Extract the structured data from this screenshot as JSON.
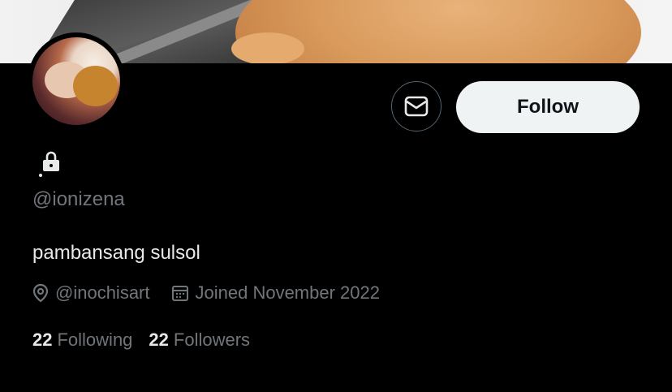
{
  "profile": {
    "handle": "@ionizena",
    "bio": "pambansang sulsol",
    "website": "@inochisart",
    "joined": "Joined November 2022",
    "following_count": "22",
    "following_label": "Following",
    "followers_count": "22",
    "followers_label": "Followers",
    "protected": true
  },
  "actions": {
    "follow_label": "Follow",
    "message_icon": "envelope-icon"
  },
  "colors": {
    "background": "#000000",
    "primary_text": "#e7e9ea",
    "secondary_text": "#71767b",
    "follow_button_bg": "#eff3f4"
  }
}
